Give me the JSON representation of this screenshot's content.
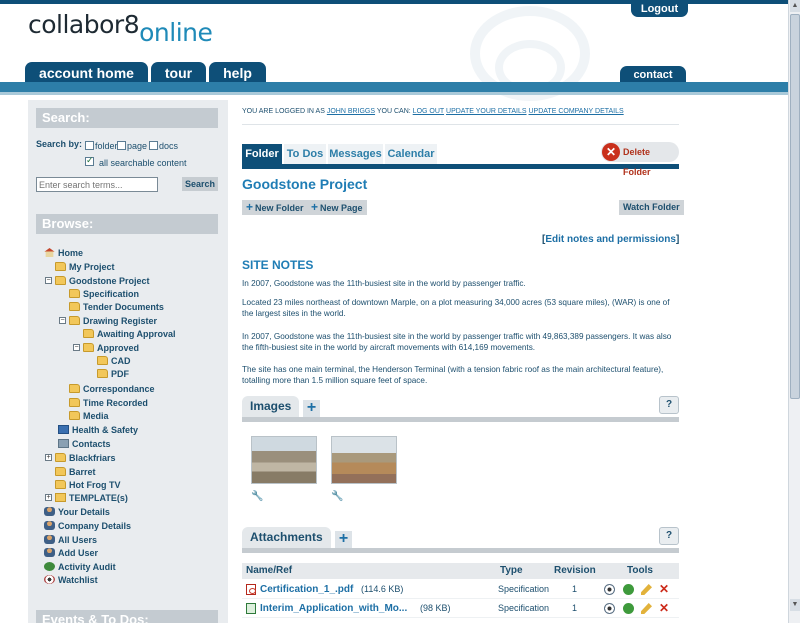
{
  "header": {
    "logo_main": "collabor8",
    "logo_accent": "online",
    "logout_label": "Logout",
    "nav": [
      {
        "label": "account home"
      },
      {
        "label": "tour"
      },
      {
        "label": "help"
      }
    ],
    "contact_label": "contact"
  },
  "sidebar": {
    "search_title": "Search:",
    "search_by_label": "Search by:",
    "options": [
      {
        "label": "folder",
        "checked": false
      },
      {
        "label": "page",
        "checked": false
      },
      {
        "label": "docs",
        "checked": false
      },
      {
        "label": "all searchable content",
        "checked": true
      }
    ],
    "search_placeholder": "Enter search terms...",
    "search_button": "Search",
    "browse_title": "Browse:",
    "tree": [
      {
        "label": "Home",
        "icon": "home-icon"
      },
      {
        "label": "My Project",
        "icon": "folder-icon"
      },
      {
        "label": "Goodstone Project",
        "icon": "folder-icon"
      },
      {
        "label": "Specification",
        "icon": "folder-icon"
      },
      {
        "label": "Tender Documents",
        "icon": "folder-icon"
      },
      {
        "label": "Drawing Register",
        "icon": "folder-icon"
      },
      {
        "label": "Awaiting Approval",
        "icon": "folder-icon"
      },
      {
        "label": "Approved",
        "icon": "folder-icon"
      },
      {
        "label": "CAD",
        "icon": "folder-icon"
      },
      {
        "label": "PDF",
        "icon": "folder-icon"
      },
      {
        "label": "Correspondance",
        "icon": "folder-icon"
      },
      {
        "label": "Time Recorded",
        "icon": "folder-icon"
      },
      {
        "label": "Media",
        "icon": "folder-icon"
      },
      {
        "label": "Health & Safety",
        "icon": "monitor-icon"
      },
      {
        "label": "Contacts",
        "icon": "contacts-icon"
      },
      {
        "label": "Blackfriars",
        "icon": "folder-icon"
      },
      {
        "label": "Barret",
        "icon": "folder-icon"
      },
      {
        "label": "Hot Frog TV",
        "icon": "folder-icon"
      },
      {
        "label": "TEMPLATE(s)",
        "icon": "template-icon"
      },
      {
        "label": "Your Details",
        "icon": "user-icon"
      },
      {
        "label": "Company Details",
        "icon": "user-icon"
      },
      {
        "label": "All Users",
        "icon": "users-icon"
      },
      {
        "label": "Add User",
        "icon": "add-user-icon"
      },
      {
        "label": "Activity Audit",
        "icon": "audit-icon"
      },
      {
        "label": "Watchlist",
        "icon": "eye-icon"
      }
    ],
    "events_title": "Events & To Dos:"
  },
  "main": {
    "logged_prefix": "YOU ARE LOGGED IN AS",
    "user_name": "JOHN BRIGGS",
    "can_text": "YOU CAN:",
    "logout_link": "LOG OUT",
    "update_details": "UPDATE YOUR DETAILS",
    "update_company": "UPDATE COMPANY DETAILS",
    "tabs": [
      {
        "label": "Folder",
        "active": true
      },
      {
        "label": "To Dos",
        "active": false
      },
      {
        "label": "Messages",
        "active": false
      },
      {
        "label": "Calendar",
        "active": false
      }
    ],
    "delete_folder": "Delete Folder",
    "project_title": "Goodstone Project",
    "new_folder": "New Folder",
    "new_page": "New Page",
    "watch_folder": "Watch Folder",
    "edit_notes": "Edit notes and permissions",
    "site_notes_title": "SITE NOTES",
    "paragraphs": [
      "In 2007, Goodstone  was the 11th-busiest site in the world by passenger traffic.",
      "Located 23 miles northeast of downtown Marple, on a plot measuring 34,000 acres (53 square miles), (WAR) is one of the largest sites in the world.",
      "In 2007, Goodstone was the 11th-busiest site in the world by passenger traffic with 49,863,389 passengers. It was also the fifth-busiest site in the world by aircraft movements with 614,169 movements.",
      "The site has one main terminal, the Henderson Terminal (with a tension fabric roof as the main architectural feature), totalling more than 1.5 million square feet of space."
    ],
    "images_title": "Images",
    "attachments_title": "Attachments",
    "help_label": "?",
    "columns": [
      "Name/Ref",
      "Type",
      "Revision",
      "Tools"
    ],
    "attachments": [
      {
        "name": "Certification_1_.pdf",
        "size": "(114.6 KB)",
        "type": "Specification",
        "revision": "1",
        "icon": "pdf-icon"
      },
      {
        "name": "Interim_Application_with_Mo...",
        "size": "(98 KB)",
        "type": "Specification",
        "revision": "1",
        "icon": "spreadsheet-icon"
      }
    ]
  }
}
